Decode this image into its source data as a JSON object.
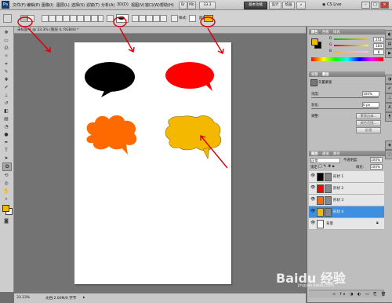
{
  "app": {
    "logo": "Ps",
    "zoom_combo": "33.3",
    "workspace_label": "基本功能",
    "workspace_labels": [
      "基本功能",
      "设计",
      "绘画"
    ],
    "cslive": "CS Live"
  },
  "menu": [
    "文件(F)",
    "编辑(E)",
    "图像(I)",
    "图层(L)",
    "选择(S)",
    "滤镜(T)",
    "分析(A)",
    "3D(D)",
    "视图(V)",
    "窗口(W)",
    "帮助(H)"
  ],
  "window_controls": [
    "–",
    "□",
    "×"
  ],
  "options_bar": {
    "style_label": "样式:",
    "color_label": "颜色:",
    "color": "#f5b800"
  },
  "document": {
    "tab_title": "未标题-1 @ 33.3% (图层 4, RGB/8) *",
    "status_zoom": "33.33%",
    "status_doc": "文档:2.00M/0 字节"
  },
  "shapes": [
    {
      "name": "black-speech-bubble",
      "color": "#000000"
    },
    {
      "name": "red-speech-bubble",
      "color": "#ff0000"
    },
    {
      "name": "orange-cloud-bubble",
      "color": "#ff6a00"
    },
    {
      "name": "yellow-cloud-bubble",
      "color": "#f5b800"
    }
  ],
  "color_panel": {
    "tabs": [
      "颜色",
      "色板",
      "样式"
    ],
    "channels": [
      {
        "label": "R",
        "value": "251"
      },
      {
        "label": "G",
        "value": "184"
      },
      {
        "label": "B",
        "value": "8"
      }
    ]
  },
  "adjust_panel": {
    "tabs": [
      "调整",
      "蒙版"
    ],
    "title": "矢量蒙版",
    "density_label": "浓度:",
    "density_value": "100%",
    "feather_label": "羽化:",
    "feather_value": "0 px",
    "refine_label": "调整:",
    "buttons": [
      "蒙版边缘...",
      "颜色范围...",
      "反相"
    ]
  },
  "layers_panel": {
    "tabs": [
      "图层",
      "通道",
      "路径"
    ],
    "blend_mode": "正常",
    "opacity_label": "不透明度:",
    "opacity_value": "100%",
    "lock_label": "锁定:",
    "fill_label": "填充:",
    "fill_value": "100%",
    "layers": [
      {
        "name": "形状 1",
        "color": "#000000",
        "selected": false
      },
      {
        "name": "形状 2",
        "color": "#ff0000",
        "selected": false
      },
      {
        "name": "形状 3",
        "color": "#ff6a00",
        "selected": false
      },
      {
        "name": "形状 4",
        "color": "#f5b800",
        "selected": true
      },
      {
        "name": "背景",
        "color": "#ffffff",
        "selected": false
      }
    ]
  },
  "watermark": "Baidu 经验",
  "watermark_url": "jingyan.baidu.com"
}
